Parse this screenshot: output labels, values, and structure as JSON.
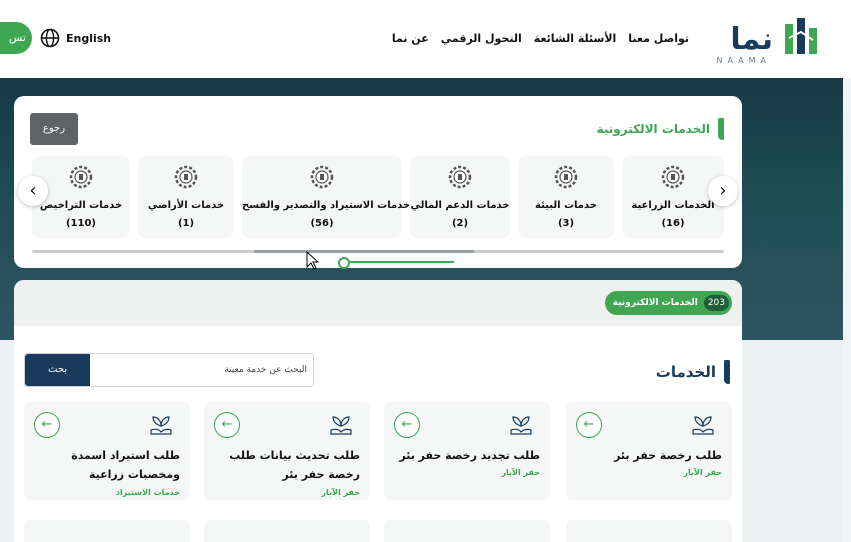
{
  "header": {
    "logo_text": "نما",
    "logo_sub": "NAAMA",
    "nav": [
      "عن نما",
      "التحول الرقمي",
      "الأسئلة الشائعة",
      "تواصل معنا"
    ],
    "language": "English",
    "register_label": "تس"
  },
  "eservices": {
    "title": "الخدمات الالكترونية",
    "back_label": "رجوع",
    "categories": [
      {
        "name": "الخدمات الزراعية",
        "count": "(16)"
      },
      {
        "name": "خدمات البيئة",
        "count": "(3)"
      },
      {
        "name": "خدمات الدعم المالي",
        "count": "(2)"
      },
      {
        "name": "خدمات الاستيراد والتصدير والفسح",
        "count": "(56)"
      },
      {
        "name": "خدمات الأراضي",
        "count": "(1)"
      },
      {
        "name": "خدمات التراخيص",
        "count": "(110)"
      }
    ],
    "prev_icon": "‹",
    "next_icon": "›"
  },
  "services": {
    "count_badge": "203",
    "count_label": "الخدمات الالكترونية",
    "title": "الخدمات",
    "search_placeholder": "البحث عن خدمة معينة",
    "search_button": "بحث",
    "go_icon": "←",
    "cards": [
      {
        "title": "طلب رخصة حفر بئر",
        "tag": "حفر الآبار"
      },
      {
        "title": "طلب تجديد رخصة حفر بئر",
        "tag": "حفر الآبار"
      },
      {
        "title": "طلب تحديث بيانات طلب رخصة حفر بئر",
        "tag": "حفر الآبار"
      },
      {
        "title": "طلب استيراد اسمدة ومخصبات زراعية",
        "tag": "خدمات الاستيراد"
      }
    ]
  },
  "colors": {
    "green": "#3fa652",
    "navy": "#1a3a5c"
  }
}
